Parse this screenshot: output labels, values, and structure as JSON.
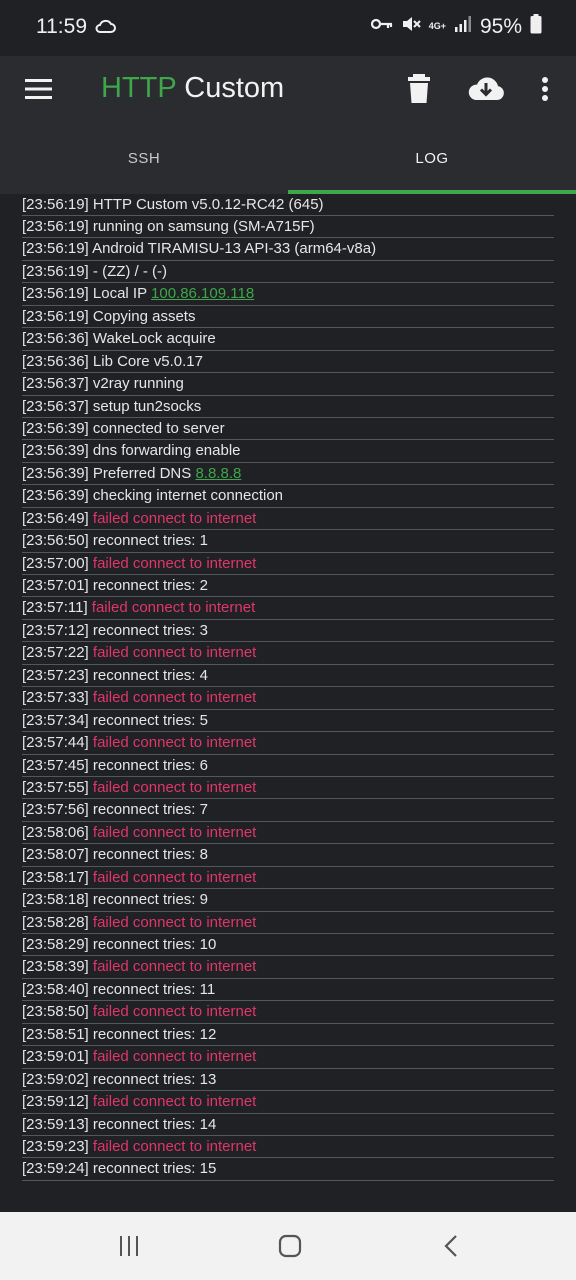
{
  "status_bar": {
    "time": "11:59",
    "network_label": "4G+",
    "battery": "95%",
    "icons": [
      "cloud-icon",
      "key-icon",
      "mute-icon",
      "signal-icon",
      "battery-icon"
    ]
  },
  "app_bar": {
    "title_part1": "HTTP",
    "title_part2": "Custom",
    "icons": [
      "menu-icon",
      "delete-icon",
      "download-icon",
      "more-icon"
    ]
  },
  "tabs": [
    {
      "label": "SSH",
      "active": false
    },
    {
      "label": "LOG",
      "active": true
    }
  ],
  "log": {
    "header_partial": "[23:56:19] HTTP Custom v5.0.12-RC42 (645)",
    "entries": [
      {
        "ts": "[23:56:19]",
        "msg": "running on samsung (SM-A715F)",
        "type": "normal"
      },
      {
        "ts": "[23:56:19]",
        "msg": "Android TIRAMISU-13 API-33 (arm64-v8a)",
        "type": "normal"
      },
      {
        "ts": "[23:56:19]",
        "msg": "- (ZZ) / - (-)",
        "type": "normal"
      },
      {
        "ts": "[23:56:19]",
        "msg": "Local IP",
        "link": "100.86.109.118",
        "type": "link"
      },
      {
        "ts": "[23:56:19]",
        "msg": "Copying assets",
        "type": "normal"
      },
      {
        "ts": "[23:56:36]",
        "msg": "WakeLock acquire",
        "type": "normal"
      },
      {
        "ts": "[23:56:36]",
        "msg": "Lib Core v5.0.17",
        "type": "normal"
      },
      {
        "ts": "[23:56:37]",
        "msg": "v2ray running",
        "type": "normal"
      },
      {
        "ts": "[23:56:37]",
        "msg": "setup tun2socks",
        "type": "normal"
      },
      {
        "ts": "[23:56:39]",
        "msg": "connected to server",
        "type": "normal"
      },
      {
        "ts": "[23:56:39]",
        "msg": "dns forwarding enable",
        "type": "normal"
      },
      {
        "ts": "[23:56:39]",
        "msg": "Preferred DNS",
        "link": "8.8.8.8",
        "type": "link"
      },
      {
        "ts": "[23:56:39]",
        "msg": "checking internet connection",
        "type": "normal"
      },
      {
        "ts": "[23:56:49]",
        "msg": "failed connect to internet",
        "type": "error"
      },
      {
        "ts": "[23:56:50]",
        "msg": "reconnect tries: 1",
        "type": "normal"
      },
      {
        "ts": "[23:57:00]",
        "msg": "failed connect to internet",
        "type": "error"
      },
      {
        "ts": "[23:57:01]",
        "msg": "reconnect tries: 2",
        "type": "normal"
      },
      {
        "ts": "[23:57:11]",
        "msg": "failed connect to internet",
        "type": "error"
      },
      {
        "ts": "[23:57:12]",
        "msg": "reconnect tries: 3",
        "type": "normal"
      },
      {
        "ts": "[23:57:22]",
        "msg": "failed connect to internet",
        "type": "error"
      },
      {
        "ts": "[23:57:23]",
        "msg": "reconnect tries: 4",
        "type": "normal"
      },
      {
        "ts": "[23:57:33]",
        "msg": "failed connect to internet",
        "type": "error"
      },
      {
        "ts": "[23:57:34]",
        "msg": "reconnect tries: 5",
        "type": "normal"
      },
      {
        "ts": "[23:57:44]",
        "msg": "failed connect to internet",
        "type": "error"
      },
      {
        "ts": "[23:57:45]",
        "msg": "reconnect tries: 6",
        "type": "normal"
      },
      {
        "ts": "[23:57:55]",
        "msg": "failed connect to internet",
        "type": "error"
      },
      {
        "ts": "[23:57:56]",
        "msg": "reconnect tries: 7",
        "type": "normal"
      },
      {
        "ts": "[23:58:06]",
        "msg": "failed connect to internet",
        "type": "error"
      },
      {
        "ts": "[23:58:07]",
        "msg": "reconnect tries: 8",
        "type": "normal"
      },
      {
        "ts": "[23:58:17]",
        "msg": "failed connect to internet",
        "type": "error"
      },
      {
        "ts": "[23:58:18]",
        "msg": "reconnect tries: 9",
        "type": "normal"
      },
      {
        "ts": "[23:58:28]",
        "msg": "failed connect to internet",
        "type": "error"
      },
      {
        "ts": "[23:58:29]",
        "msg": "reconnect tries: 10",
        "type": "normal"
      },
      {
        "ts": "[23:58:39]",
        "msg": "failed connect to internet",
        "type": "error"
      },
      {
        "ts": "[23:58:40]",
        "msg": "reconnect tries: 11",
        "type": "normal"
      },
      {
        "ts": "[23:58:50]",
        "msg": "failed connect to internet",
        "type": "error"
      },
      {
        "ts": "[23:58:51]",
        "msg": "reconnect tries: 12",
        "type": "normal"
      },
      {
        "ts": "[23:59:01]",
        "msg": "failed connect to internet",
        "type": "error"
      },
      {
        "ts": "[23:59:02]",
        "msg": "reconnect tries: 13",
        "type": "normal"
      },
      {
        "ts": "[23:59:12]",
        "msg": "failed connect to internet",
        "type": "error"
      },
      {
        "ts": "[23:59:13]",
        "msg": "reconnect tries: 14",
        "type": "normal"
      },
      {
        "ts": "[23:59:23]",
        "msg": "failed connect to internet",
        "type": "error"
      },
      {
        "ts": "[23:59:24]",
        "msg": "reconnect tries: 15",
        "type": "normal"
      }
    ]
  },
  "nav_bar": {
    "icons": [
      "recent-apps-icon",
      "home-icon",
      "back-icon"
    ]
  },
  "colors": {
    "accent_green": "#3fa64a",
    "error_red": "#e0366a",
    "background": "#1f2124",
    "app_bar": "#2a2c2f"
  }
}
